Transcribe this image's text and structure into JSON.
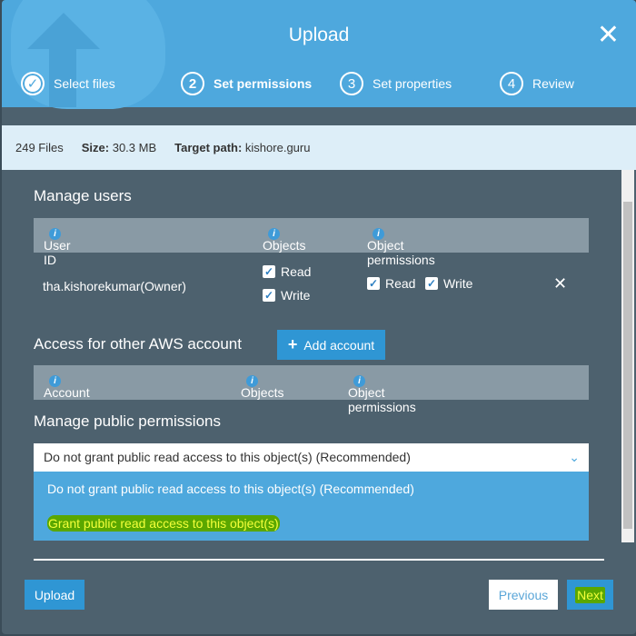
{
  "header": {
    "title": "Upload",
    "close_icon": "close-icon",
    "steps": [
      {
        "label": "Select files",
        "marker": "✓",
        "state": "done"
      },
      {
        "label": "Set permissions",
        "marker": "2",
        "state": "active"
      },
      {
        "label": "Set properties",
        "marker": "3",
        "state": "pending"
      },
      {
        "label": "Review",
        "marker": "4",
        "state": "pending"
      }
    ]
  },
  "info": {
    "files": "249 Files",
    "size_label": "Size:",
    "size": "30.3 MB",
    "path_label": "Target path:",
    "path": "kishore.guru"
  },
  "manage_users": {
    "title": "Manage users",
    "columns": [
      "User ID",
      "Objects",
      "Object permissions"
    ],
    "row": {
      "user": "tha.kishorekumar(Owner)",
      "objects": [
        "Read",
        "Write"
      ],
      "object_permissions": [
        "Read",
        "Write"
      ]
    }
  },
  "other_account": {
    "title": "Access for other AWS account",
    "add_button": "Add account",
    "columns": [
      "Account",
      "Objects",
      "Object permissions"
    ]
  },
  "public": {
    "title": "Manage public permissions",
    "selected": "Do not grant public read access to this object(s) (Recommended)",
    "options": [
      "Do not grant public read access to this object(s) (Recommended)",
      "Grant public read access to this object(s)"
    ]
  },
  "footer": {
    "upload": "Upload",
    "previous": "Previous",
    "next": "Next"
  }
}
